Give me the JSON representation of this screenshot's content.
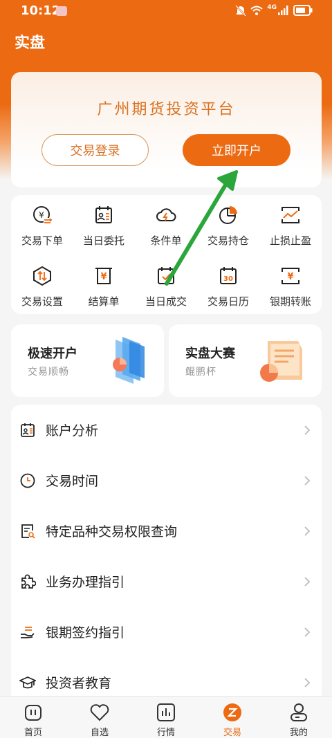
{
  "status": {
    "time": "10:12",
    "network": "4G"
  },
  "appbar": {
    "title": "实盘"
  },
  "hero": {
    "title": "广州期货投资平台",
    "login_label": "交易登录",
    "open_label": "立即开户"
  },
  "grid": [
    {
      "label": "交易下单",
      "icon": "yen-exchange-icon"
    },
    {
      "label": "当日委托",
      "icon": "entrust-icon"
    },
    {
      "label": "条件单",
      "icon": "cloud-lightning-icon"
    },
    {
      "label": "交易持仓",
      "icon": "pie-chart-icon"
    },
    {
      "label": "止损止盈",
      "icon": "trend-frame-icon"
    },
    {
      "label": "交易设置",
      "icon": "hexagon-arrows-icon"
    },
    {
      "label": "结算单",
      "icon": "yen-receipt-icon"
    },
    {
      "label": "当日成交",
      "icon": "calendar-check-icon"
    },
    {
      "label": "交易日历",
      "icon": "calendar-30-icon"
    },
    {
      "label": "银期转账",
      "icon": "yen-transfer-icon"
    }
  ],
  "promos": [
    {
      "title": "极速开户",
      "subtitle": "交易顺畅",
      "icon": "fast-open-illustration"
    },
    {
      "title": "实盘大赛",
      "subtitle": "鲲鹏杯",
      "icon": "contest-illustration"
    }
  ],
  "menu": [
    {
      "label": "账户分析",
      "icon": "account-analysis-icon"
    },
    {
      "label": "交易时间",
      "icon": "clock-icon"
    },
    {
      "label": "特定品种交易权限查询",
      "icon": "document-search-icon"
    },
    {
      "label": "业务办理指引",
      "icon": "puzzle-icon"
    },
    {
      "label": "银期签约指引",
      "icon": "hand-coin-icon"
    },
    {
      "label": "投资者教育",
      "icon": "graduation-cap-icon"
    }
  ],
  "tabs": [
    {
      "label": "首页",
      "icon": "home-icon"
    },
    {
      "label": "自选",
      "icon": "heart-icon"
    },
    {
      "label": "行情",
      "icon": "bar-chart-icon"
    },
    {
      "label": "交易",
      "icon": "trade-icon"
    },
    {
      "label": "我的",
      "icon": "profile-icon"
    }
  ],
  "colors": {
    "accent": "#ec6a12",
    "accent_text": "#d9701f",
    "annotation_arrow": "#2aa63a"
  }
}
